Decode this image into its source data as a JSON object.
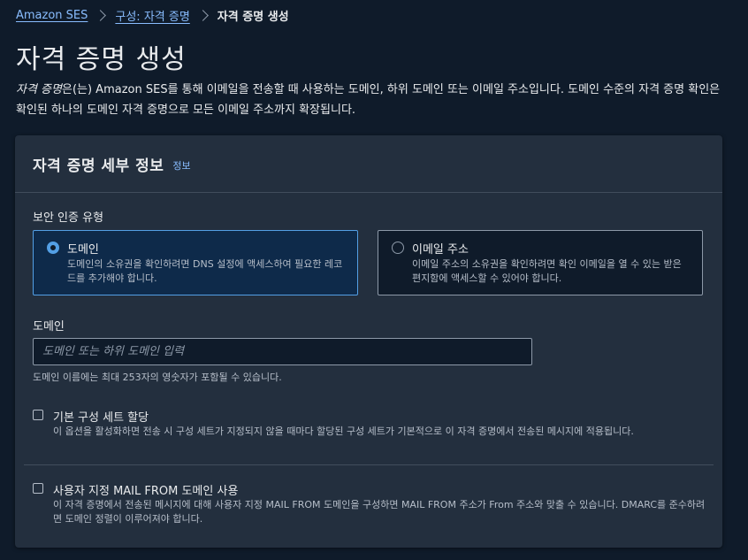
{
  "breadcrumb": {
    "root": "Amazon SES",
    "parent": "구성: 자격 증명",
    "current": "자격 증명 생성"
  },
  "page": {
    "title": "자격 증명 생성",
    "desc_em": "자격 증명",
    "desc_rest": "은(는) Amazon SES를 통해 이메일을 전송할 때 사용하는 도메인, 하위 도메인 또는 이메일 주소입니다. 도메인 수준의 자격 증명 확인은 확인된 하나의 도메인 자격 증명으로 모든 이메일 주소까지 확장됩니다."
  },
  "details": {
    "title": "자격 증명 세부 정보",
    "info_link": "정보",
    "identity_type_label": "보안 인증 유형",
    "options": [
      {
        "title": "도메인",
        "description": "도메인의 소유권을 확인하려면 DNS 설정에 액세스하여 필요한 레코드를 추가해야 합니다.",
        "selected": true
      },
      {
        "title": "이메일 주소",
        "description": "이메일 주소의 소유권을 확인하려면 확인 이메일을 열 수 있는 받은 편지함에 액세스할 수 있어야 합니다.",
        "selected": false
      }
    ],
    "domain": {
      "label": "도메인",
      "value": "",
      "placeholder": "도메인 또는 하위 도메인 입력",
      "constraint": "도메인 이름에는 최대 253자의 영숫자가 포함될 수 있습니다."
    },
    "config_set": {
      "label": "기본 구성 세트 할당",
      "description": "이 옵션을 활성화하면 전송 시 구성 세트가 지정되지 않을 때마다 할당된 구성 세트가 기본적으로 이 자격 증명에서 전송된 메시지에 적용됩니다.",
      "checked": false
    },
    "mail_from": {
      "label": "사용자 지정 MAIL FROM 도메인 사용",
      "description": "이 자격 증명에서 전송된 메시지에 대해 사용자 지정 MAIL FROM 도메인을 구성하면 MAIL FROM 주소가 From 주소와 맞출 수 있습니다. DMARC를 준수하려면 도메인 정렬이 이루어져야 합니다.",
      "checked": false
    }
  },
  "colors": {
    "background": "#0f1b2a",
    "panel": "#232f3e",
    "link": "#89bdff",
    "accent": "#539fe5"
  }
}
